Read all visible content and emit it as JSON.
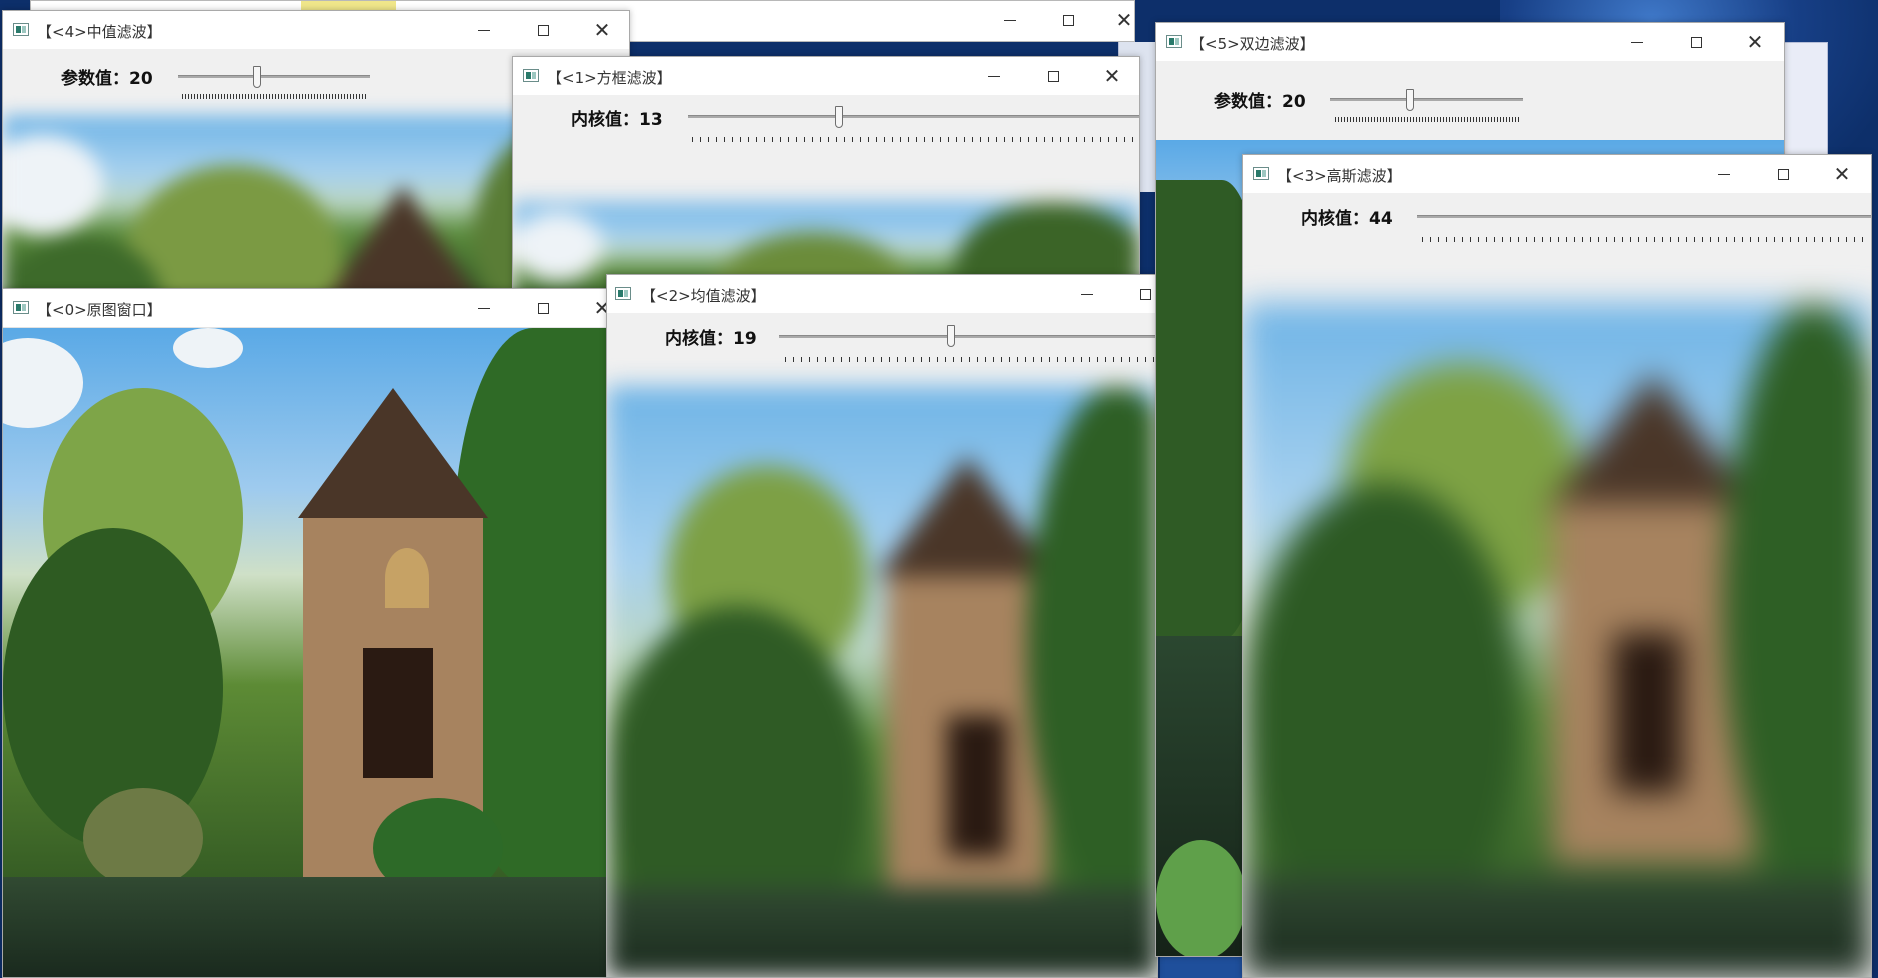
{
  "windows": {
    "median": {
      "title": "【<4>中值滤波】",
      "label": "参数值：20",
      "value": 20
    },
    "box": {
      "title": "【<1>方框滤波】",
      "label": "内核值：13",
      "value": 13
    },
    "bilateral": {
      "title": "【<5>双边滤波】",
      "label": "参数值：20",
      "value": 20
    },
    "gaussian": {
      "title": "【<3>高斯滤波】",
      "label": "内核值：44",
      "value": 44
    },
    "original": {
      "title": "【<0>原图窗口】"
    },
    "blur": {
      "title": "【<2>均值滤波】",
      "label": "内核值：19",
      "value": 19
    }
  },
  "icons": {
    "app": "opencv-window-icon",
    "minimize": "minimize-icon",
    "maximize": "maximize-icon",
    "close": "close-icon"
  }
}
